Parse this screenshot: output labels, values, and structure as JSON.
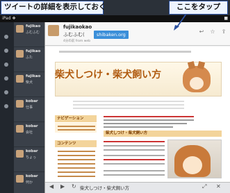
{
  "callouts": {
    "left": "ツイートの詳細を表示しておく",
    "right": "ここをタップ"
  },
  "status_bar": {
    "left": "iPad ❖",
    "right": "■"
  },
  "tweet": {
    "user": "fujikaokao",
    "screen_name": "ふむふむ(",
    "link_label": "shibaken.org",
    "meta": "4分の前 from web"
  },
  "timeline": [
    {
      "name": "fujikao",
      "text": "ふむふむ"
    },
    {
      "name": "fujikao",
      "text": "ふた"
    },
    {
      "name": "fujikao",
      "text": "柴犬"
    },
    {
      "name": "kobar",
      "text": "仕事"
    },
    {
      "name": "kobar",
      "text": "会社"
    },
    {
      "name": "kobar",
      "text": "ちょっ"
    },
    {
      "name": "kobar",
      "text": "何か"
    }
  ],
  "website": {
    "title": "柴犬しつけ・柴犬飼い方",
    "nav_head_1": "ナビゲーション",
    "nav_head_2": "コンテンツ",
    "right_head": "柴犬しつけ・柴犬飼い方"
  },
  "bottom_bar": {
    "title": "柴犬しつけ・柴犬飼い方"
  },
  "colors": {
    "callout_border": "#2a4f9e",
    "link_button": "#3b8fd9",
    "site_title": "#b05a0e"
  }
}
